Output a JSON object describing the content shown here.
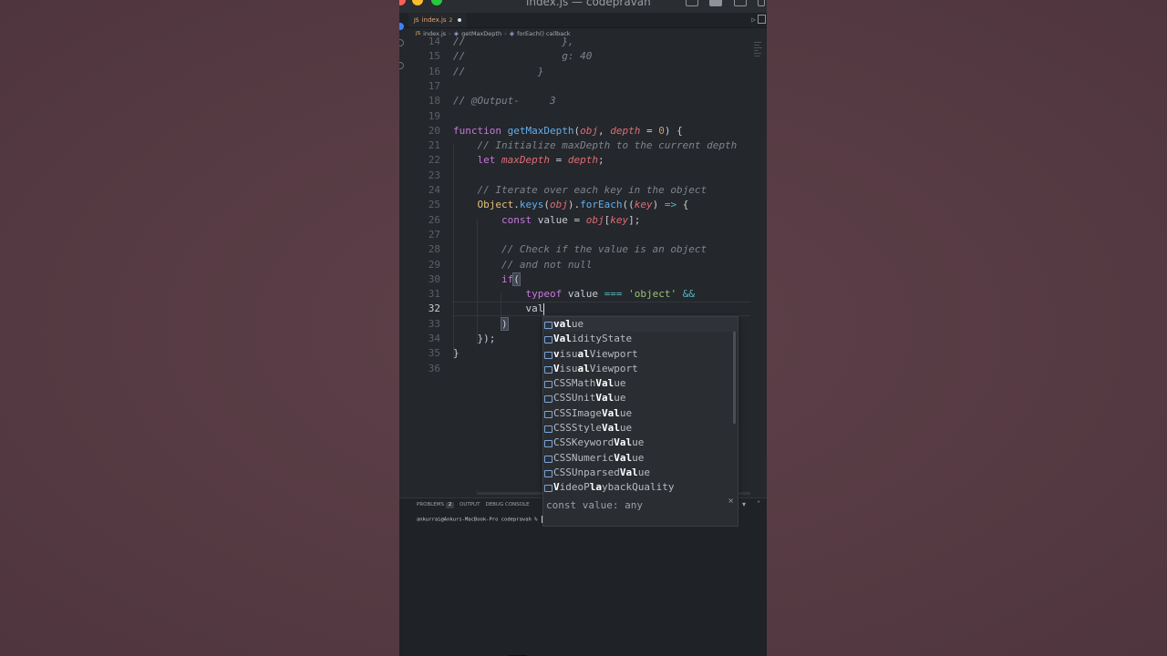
{
  "window": {
    "title": "index.js — codepravah"
  },
  "tab": {
    "icon": "js-file-icon",
    "icon_text": "JS",
    "name": "index.js",
    "problems_count": "2"
  },
  "breadcrumb": {
    "file": "index.js",
    "function": "getMaxDepth",
    "callback": "forEach() callback"
  },
  "code_lines": [
    {
      "n": "14",
      "text": "//                },"
    },
    {
      "n": "15",
      "text": "//                g: 40"
    },
    {
      "n": "16",
      "text": "//            }"
    },
    {
      "n": "17",
      "text": ""
    },
    {
      "n": "18",
      "text": "// @Output-     3"
    },
    {
      "n": "19",
      "text": ""
    },
    {
      "n": "20",
      "text": "function getMaxDepth(obj, depth = 0) {"
    },
    {
      "n": "21",
      "text": "    // Initialize maxDepth to the current depth"
    },
    {
      "n": "22",
      "text": "    let maxDepth = depth;"
    },
    {
      "n": "23",
      "text": ""
    },
    {
      "n": "24",
      "text": "    // Iterate over each key in the object"
    },
    {
      "n": "25",
      "text": "    Object.keys(obj).forEach((key) => {"
    },
    {
      "n": "26",
      "text": "        const value = obj[key];"
    },
    {
      "n": "27",
      "text": ""
    },
    {
      "n": "28",
      "text": "        // Check if the value is an object"
    },
    {
      "n": "29",
      "text": "        // and not null"
    },
    {
      "n": "30",
      "text": "        if("
    },
    {
      "n": "31",
      "text": "            typeof value === 'object' &&"
    },
    {
      "n": "32",
      "text": "            val"
    },
    {
      "n": "33",
      "text": "        )"
    },
    {
      "n": "34",
      "text": "    });"
    },
    {
      "n": "35",
      "text": "}"
    },
    {
      "n": "36",
      "text": ""
    }
  ],
  "suggestions": [
    {
      "pre": "",
      "match": "val",
      "post": "ue",
      "label": "value"
    },
    {
      "pre": "",
      "match": "Val",
      "post": "idityState",
      "label": "ValidityState"
    },
    {
      "pre": "",
      "match": "v",
      "post": "isu",
      "match2": "al",
      "post2": "Viewport",
      "label": "visualViewport"
    },
    {
      "pre": "",
      "match": "V",
      "post": "isu",
      "match2": "al",
      "post2": "Viewport",
      "label": "VisualViewport"
    },
    {
      "pre": "CSSMath",
      "match": "Val",
      "post": "ue",
      "label": "CSSMathValue"
    },
    {
      "pre": "CSSUnit",
      "match": "Val",
      "post": "ue",
      "label": "CSSUnitValue"
    },
    {
      "pre": "CSSImage",
      "match": "Val",
      "post": "ue",
      "label": "CSSImageValue"
    },
    {
      "pre": "CSSStyle",
      "match": "Val",
      "post": "ue",
      "label": "CSSStyleValue"
    },
    {
      "pre": "CSSKeyword",
      "match": "Val",
      "post": "ue",
      "label": "CSSKeywordValue"
    },
    {
      "pre": "CSSNumeric",
      "match": "Val",
      "post": "ue",
      "label": "CSSNumericValue"
    },
    {
      "pre": "CSSUnparsed",
      "match": "Val",
      "post": "ue",
      "label": "CSSUnparsedValue"
    },
    {
      "pre": "",
      "match": "V",
      "post": "ideoP",
      "match2": "la",
      "post2": "ybackQuality",
      "label": "VideoPlaybackQuality"
    }
  ],
  "suggestion_icon_text": "[▪]",
  "details": {
    "text": "const value: any",
    "close": "×"
  },
  "panel": {
    "tabs": {
      "problems": "PROBLEMS",
      "problems_count": "2",
      "output": "OUTPUT",
      "debug_console": "DEBUG CONSOLE"
    },
    "terminal_prompt": "ankurrai@Ankurs-MacBook-Pro codepravah % "
  },
  "colors": {
    "editor_bg": "#24272b",
    "comment": "#7f848e",
    "keyword": "#c678dd",
    "function": "#61afef",
    "param": "#e06c75",
    "number": "#d19a66",
    "string": "#98c379"
  }
}
